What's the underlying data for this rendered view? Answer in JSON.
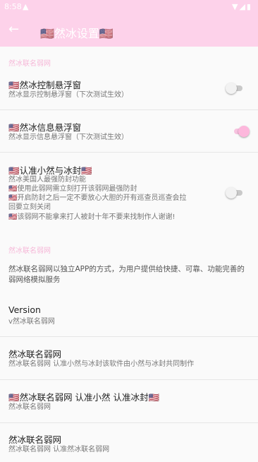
{
  "status_bar": {
    "time": "8:58",
    "warning": "▲",
    "icons": "▼◢▮"
  },
  "app_bar": {
    "back_icon": "←",
    "title": "🇺🇸然冰设置🇺🇸"
  },
  "section1": {
    "header": "然冰联名弱网",
    "items": [
      {
        "title": "🇺🇸然冰控制悬浮窗",
        "subtitle": "然冰显示控制悬浮窗（下次测试生效）",
        "enabled": false
      },
      {
        "title": "🇺🇸然冰信息悬浮窗",
        "subtitle": "然冰显示信息悬浮窗（下次测试生效）",
        "enabled": true
      },
      {
        "title": "🇺🇸认准小然与冰封🇺🇸",
        "lines": [
          "然冰美国人最强防封功能",
          "🇺🇸使用此弱网需立刻打开该弱网最强防封",
          "🇺🇸开启防封之后一定不要放心大胆的开有巡查员巡查会拉",
          "回要立刻关闭",
          "🇺🇸该弱网不能拿来打人被封十年不要来找制作人谢谢!"
        ],
        "enabled": false
      }
    ]
  },
  "section2": {
    "header": "然冰联名弱网",
    "description": "然冰联名弱网以独立APP的方式，为用户提供给快捷、可靠、功能完善的弱网络模拟服务",
    "items": [
      {
        "title": "Version",
        "subtitle": "v然冰联名弱网"
      },
      {
        "title": "然冰联名弱网",
        "subtitle": "然冰联名弱网  认准小然与冰封该软件由小然与冰封共同制作"
      },
      {
        "title": "🇺🇸然冰联名弱网  认准小然 认准冰封🇺🇸",
        "subtitle": "然冰联名弱网"
      },
      {
        "title": "然冰联名弱网",
        "subtitle": "然冰联名弱网  认准然冰联名弱网"
      }
    ]
  }
}
